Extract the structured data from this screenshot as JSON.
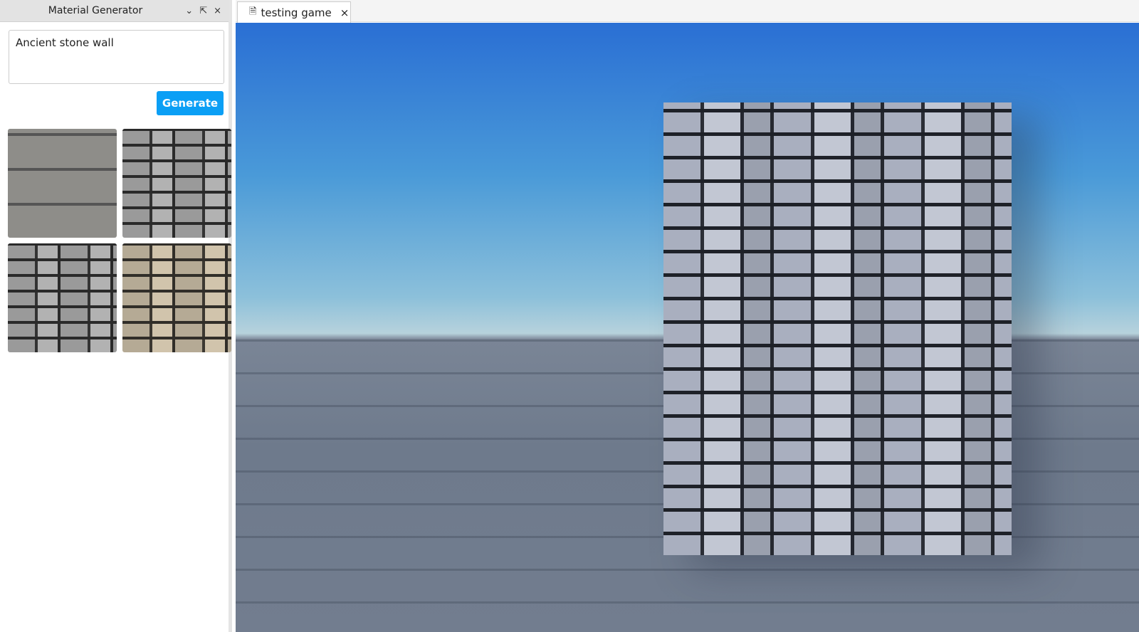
{
  "panel": {
    "title": "Material Generator",
    "prompt": "Ancient stone wall",
    "generate_label": "Generate",
    "results": [
      "stone-slab",
      "dry-stone-wall",
      "stacked-stone",
      "sandstone-brick"
    ]
  },
  "tabs": [
    {
      "label": "testing game"
    }
  ],
  "icons": {
    "dropdown": "⌄",
    "undock": "⇱",
    "close": "×",
    "script": "🗎"
  }
}
